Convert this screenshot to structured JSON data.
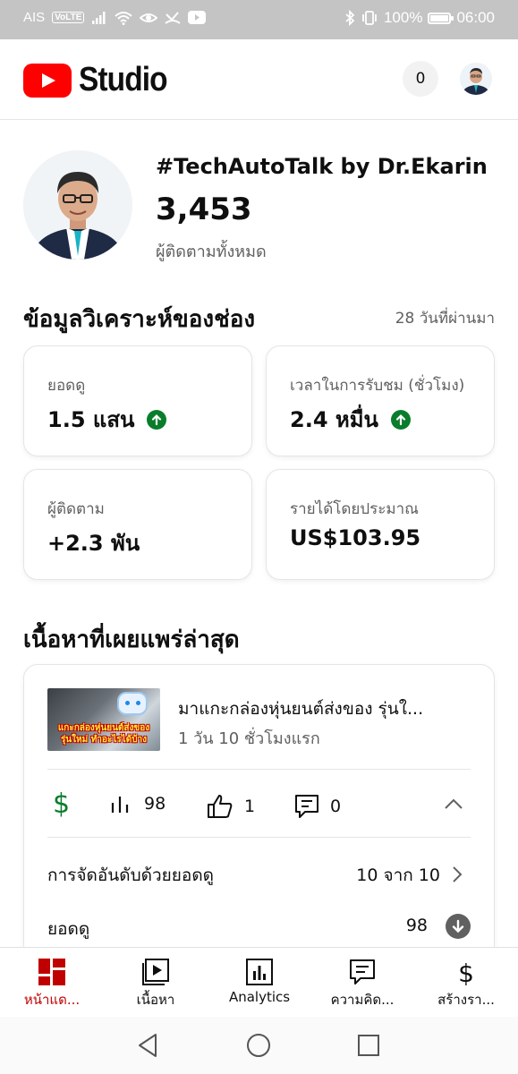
{
  "status_bar": {
    "carrier": "AIS",
    "volte": "VoLTE",
    "battery": "100%",
    "time": "06:00",
    "icons": [
      "signal-icon",
      "wifi-icon",
      "eye-icon",
      "missed-call-icon",
      "youtube-icon",
      "bluetooth-icon",
      "vibrate-icon",
      "battery-icon"
    ]
  },
  "app_bar": {
    "logo_text": "Studio",
    "notification_count": "0",
    "colors": {
      "brand": "#ff0000"
    }
  },
  "channel": {
    "name": "#TechAutoTalk by Dr.Ekarin",
    "subscriber_count": "3,453",
    "subscriber_label": "ผู้ติดตามทั้งหมด"
  },
  "analytics": {
    "title": "ข้อมูลวิเคราะห์ของช่อง",
    "period": "28 วันที่ผ่านมา",
    "cards": [
      {
        "label": "ยอดดู",
        "value": "1.5 แสน",
        "trend": "up"
      },
      {
        "label": "เวลาในการรับชม (ชั่วโมง)",
        "value": "2.4 หมื่น",
        "trend": "up"
      },
      {
        "label": "ผู้ติดตาม",
        "value": "+2.3 พัน",
        "trend": ""
      },
      {
        "label": "รายได้โดยประมาณ",
        "value": "US$103.95",
        "trend": ""
      }
    ],
    "colors": {
      "trend_up": "#0a7d2c"
    }
  },
  "latest_content": {
    "title": "เนื้อหาที่เผยแพร่ล่าสุด",
    "video": {
      "title": "มาแกะกล่องหุ่นยนต์ส่งของ รุ่นใ...",
      "meta": "1 วัน 10 ชั่วโมงแรก",
      "thumbnail_caption_1": "แกะกล่องหุ่นยนต์ส่งของ",
      "thumbnail_caption_2": "รุ่นใหม่ ทำอะไรได้บ้าง",
      "views": "98",
      "likes": "1",
      "comments": "0"
    },
    "rank_label": "การจัดอันดับด้วยยอดดู",
    "rank_value": "10 จาก 10",
    "views_label": "ยอดดู",
    "views_value": "98"
  },
  "bottom_nav": {
    "items": [
      {
        "label": "หน้าแด...",
        "icon": "dashboard-icon",
        "active": true
      },
      {
        "label": "เนื้อหา",
        "icon": "content-icon",
        "active": false
      },
      {
        "label": "Analytics",
        "icon": "analytics-icon",
        "active": false
      },
      {
        "label": "ความคิด...",
        "icon": "comments-icon",
        "active": false
      },
      {
        "label": "สร้างรา...",
        "icon": "monetization-icon",
        "active": false
      }
    ],
    "colors": {
      "active": "#c00000"
    }
  },
  "system_nav": {
    "icons": [
      "back-icon",
      "home-icon",
      "recents-icon"
    ]
  }
}
